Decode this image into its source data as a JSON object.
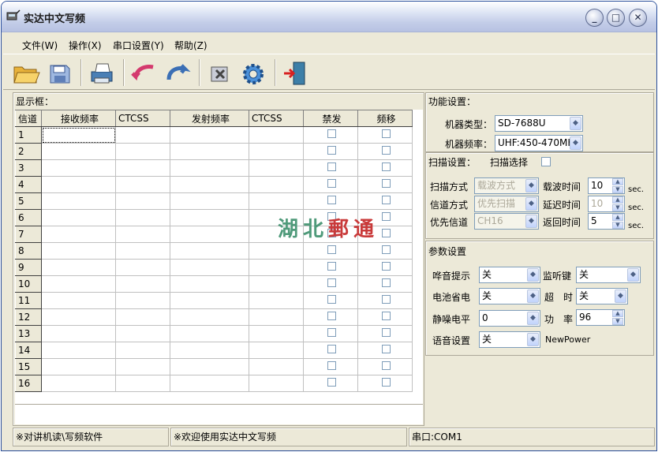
{
  "window": {
    "title": "实达中文写频",
    "minimize": "_",
    "maximize": "□",
    "close": "✕"
  },
  "menu": [
    "文件(W)",
    "操作(X)",
    "串口设置(Y)",
    "帮助(Z)"
  ],
  "toolbar": [
    "open-folder-icon",
    "save-icon",
    "print-icon",
    "read-icon",
    "write-icon",
    "settings-icon",
    "gear-icon",
    "exit-icon"
  ],
  "display": {
    "title": "显示框：",
    "columns": [
      "信道",
      "接收频率",
      "CTCSS",
      "发射频率",
      "CTCSS",
      "禁发",
      "频移"
    ],
    "rows": [
      "1",
      "2",
      "3",
      "4",
      "5",
      "6",
      "7",
      "8",
      "9",
      "10",
      "11",
      "12",
      "13",
      "14",
      "15",
      "16"
    ]
  },
  "func": {
    "title": "功能设置：",
    "model_label": "机器类型：",
    "model_value": "SD-7688U",
    "freq_label": "机器频率：",
    "freq_value": "UHF:450-470MHz"
  },
  "scan": {
    "title": "扫描设置：",
    "select_label": "扫描选择",
    "method_label": "扫描方式",
    "method_value": "载波方式",
    "channel_mode_label": "信道方式",
    "channel_mode_value": "优先扫描",
    "priority_label": "优先信道",
    "priority_value": "CH16",
    "carrier_time_label": "载波时间",
    "carrier_time_value": "10",
    "delay_time_label": "延迟时间",
    "delay_time_value": "10",
    "return_time_label": "返回时间",
    "return_time_value": "5",
    "unit": "sec."
  },
  "params": {
    "title": "参数设置",
    "beep_label": "哗音提示",
    "beep_value": "关",
    "monitor_label": "监听键",
    "monitor_value": "关",
    "battery_label": "电池省电",
    "battery_value": "关",
    "timeout_label": "超　时",
    "timeout_value": "关",
    "squelch_label": "静噪电平",
    "squelch_value": "0",
    "power_label": "功　率",
    "power_value": "96",
    "voice_label": "语音设置",
    "voice_value": "关",
    "newpower": "NewPower"
  },
  "watermark": "湖北郵通",
  "status": {
    "left": "※对讲机读\\写频软件",
    "middle": "※欢迎使用实达中文写频",
    "right": "串口:COM1"
  },
  "colors": {
    "watermark_green": "#4f9a7a",
    "watermark_red": "#c93a3a"
  }
}
